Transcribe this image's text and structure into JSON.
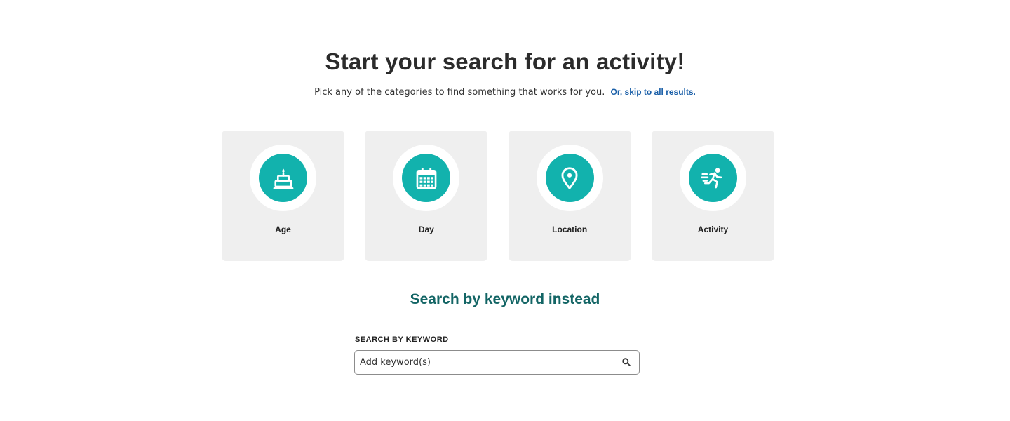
{
  "header": {
    "title": "Start your search for an activity!",
    "intro_text": "Pick any of the categories to find something that works for you.",
    "skip_link": "Or, skip to all results."
  },
  "categories": [
    {
      "label": "Age",
      "icon": "cake-icon"
    },
    {
      "label": "Day",
      "icon": "calendar-icon"
    },
    {
      "label": "Location",
      "icon": "map-pin-icon"
    },
    {
      "label": "Activity",
      "icon": "running-person-icon"
    }
  ],
  "keyword_search": {
    "heading": "Search by keyword instead",
    "field_label": "SEARCH BY KEYWORD",
    "placeholder": "Add keyword(s)",
    "value": "",
    "icon": "search-icon"
  },
  "colors": {
    "accent": "#12b2ad",
    "heading_teal": "#136565",
    "link": "#1a5fa8",
    "card_bg": "#efefef"
  }
}
